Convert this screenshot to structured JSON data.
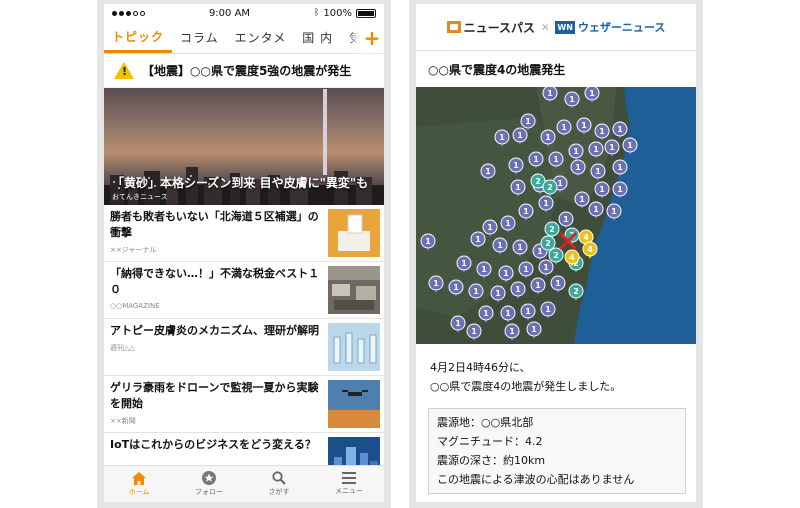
{
  "phone1": {
    "status": {
      "time": "9:00 AM",
      "battery": "100%"
    },
    "tabs": [
      {
        "label": "トピック",
        "active": true
      },
      {
        "label": "コラム",
        "active": false
      },
      {
        "label": "エンタメ",
        "active": false
      },
      {
        "label": "国 内",
        "active": false
      },
      {
        "label": "気にな",
        "active": false
      }
    ],
    "add_tab_label": "+",
    "alert": {
      "text": "【地震】○○県で震度5強の地震が発生",
      "icon": "warning-icon"
    },
    "hero": {
      "title": "「黄砂」本格シーズン到来 目や皮膚に\"異変\"も",
      "source": "おてんきニュース"
    },
    "news": [
      {
        "title": "勝者も敗者もいない「北海道５区補選」の衝撃",
        "source": "××ジャーナル"
      },
      {
        "title": "「納得できない…！」不満な税金ベスト１０",
        "source": "○○MAGAZINE"
      },
      {
        "title": "アトピー皮膚炎のメカニズム、理研が解明",
        "source": "週刊△△"
      },
      {
        "title": "ゲリラ豪雨をドローンで監視一夏から実験を開始",
        "source": "××新聞"
      },
      {
        "title": "IoTはこれからのビジネスをどう変える？",
        "source": ""
      }
    ],
    "bottom_nav": [
      {
        "label": "ホーム",
        "icon": "home-icon",
        "active": true
      },
      {
        "label": "フォロー",
        "icon": "star-icon",
        "active": false
      },
      {
        "label": "さがす",
        "icon": "search-icon",
        "active": false
      },
      {
        "label": "メニュー",
        "icon": "menu-icon",
        "active": false
      }
    ]
  },
  "phone2": {
    "header": {
      "brand1": "ニュースパス",
      "cross": "×",
      "brand2_badge": "WN",
      "brand2": "ウェザーニュース"
    },
    "title": "○○県で震度4の地震発生",
    "map_markers": {
      "intensity_1_color": "#6b6fb5",
      "intensity_2_color": "#3aa89a",
      "intensity_4_color": "#e8c21a",
      "epicenter_color": "#e02020"
    },
    "report_line1": "4月2日4時46分に、",
    "report_line2": "○○県で震度4の地震が発生しました。",
    "details": [
      "震源地：○○県北部",
      "マグニチュード：4.2",
      "震源の深さ：約10km",
      "この地震による津波の心配はありません"
    ]
  },
  "colors": {
    "accent": "#f08a00",
    "weathernews_blue": "#1b5fa8"
  }
}
